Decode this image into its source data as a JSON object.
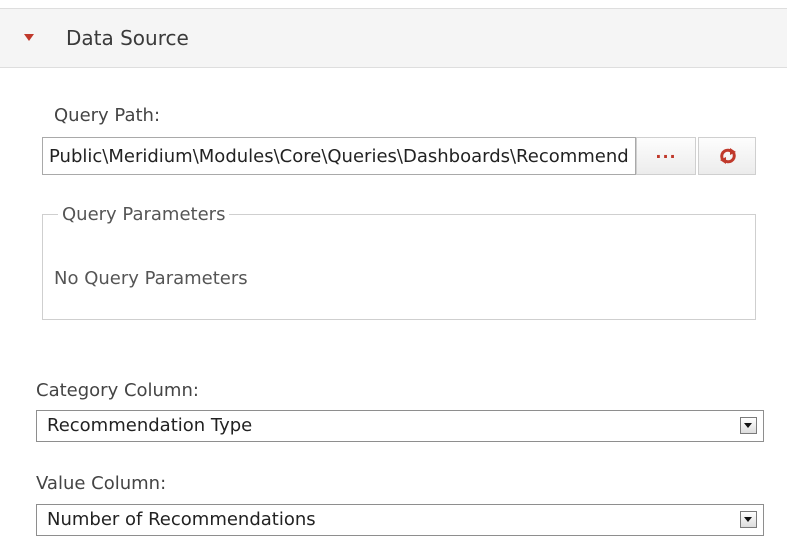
{
  "panel": {
    "title": "Data Source",
    "accent_color": "#c0392b"
  },
  "query": {
    "label": "Query Path:",
    "value": "Public\\Meridium\\Modules\\Core\\Queries\\Dashboards\\Recommendations",
    "browse_label": "...",
    "refresh_icon": "refresh-icon"
  },
  "parameters": {
    "legend": "Query Parameters",
    "empty_text": "No Query Parameters"
  },
  "category_column": {
    "label": "Category Column:",
    "selected": "Recommendation Type"
  },
  "value_column": {
    "label": "Value Column:",
    "selected": "Number of Recommendations"
  }
}
